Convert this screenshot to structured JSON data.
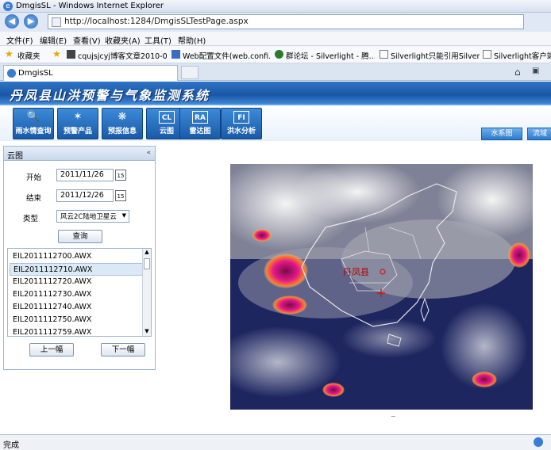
{
  "window": {
    "title": "DmgisSL - Windows Internet Explorer"
  },
  "address": {
    "url": "http://localhost:1284/DmgisSLTestPage.aspx"
  },
  "menu": [
    "文件(F)",
    "编辑(E)",
    "查看(V)",
    "收藏夹(A)",
    "工具(T)",
    "帮助(H)"
  ],
  "favorites": {
    "label": "收藏夹",
    "items": [
      "cqujsjcyj博客文章2010-0...",
      "Web配置文件(web.confi...",
      "群论坛 - Silverlight - 腾...",
      "Silverlight只能引用Silverl...",
      "Silverlight客户端调"
    ]
  },
  "tab": {
    "label": "DmgisSL"
  },
  "banner": {
    "title": "丹凤县山洪预警与气象监测系统"
  },
  "nav": [
    {
      "label": "雨水情查询",
      "icon": "search-icon",
      "glyph": "🔍"
    },
    {
      "label": "预警产品",
      "icon": "star-icon",
      "glyph": "✶"
    },
    {
      "label": "预报信息",
      "icon": "weather-icon",
      "glyph": "❋"
    },
    {
      "label": "云图",
      "icon": "cloud-map-icon",
      "glyph": "CL"
    },
    {
      "label": "雷达图",
      "icon": "radar-icon",
      "glyph": "RA"
    },
    {
      "label": "洪水分析",
      "icon": "flood-icon",
      "glyph": "FI"
    }
  ],
  "right_tabs": [
    "水系图",
    "流域"
  ],
  "panel": {
    "title": "云图",
    "start_label": "开始",
    "start_value": "2011/11/26",
    "end_label": "结束",
    "end_value": "2011/12/26",
    "type_label": "类型",
    "type_value": "风云2C陆地卫星云",
    "query_button": "查询",
    "calendar_glyph": "15",
    "files": [
      "EIL2011112700.AWX",
      "EIL2011112710.AWX",
      "EIL2011112720.AWX",
      "EIL2011112730.AWX",
      "EIL2011112740.AWX",
      "EIL2011112750.AWX",
      "EIL2011112759.AWX"
    ],
    "selected_index": 1,
    "prev_button": "上一幅",
    "next_button": "下一幅"
  },
  "map": {
    "place_label": "丹凤县"
  },
  "status": {
    "text": "完成"
  }
}
